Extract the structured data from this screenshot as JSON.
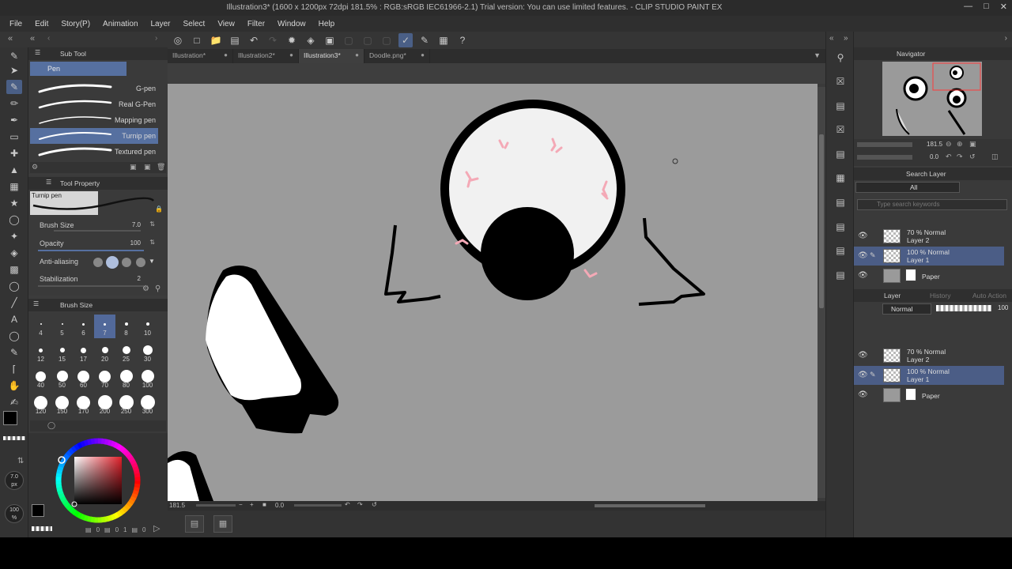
{
  "window": {
    "title": "Illustration3* (1600 x 1200px 72dpi 181.5% : RGB:sRGB IEC61966-2.1)  Trial version: You can use limited features. - CLIP STUDIO PAINT EX"
  },
  "menu": [
    "File",
    "Edit",
    "Story(P)",
    "Animation",
    "Layer",
    "Select",
    "View",
    "Filter",
    "Window",
    "Help"
  ],
  "tabs": [
    {
      "label": "Illustration*",
      "active": false
    },
    {
      "label": "Illustration2*",
      "active": false
    },
    {
      "label": "Illustration3*",
      "active": true
    },
    {
      "label": "Doodle.png*",
      "active": false
    }
  ],
  "subtool": {
    "panel_title": "Sub Tool",
    "group": "Pen",
    "items": [
      {
        "label": "G-pen",
        "selected": false
      },
      {
        "label": "Real G-Pen",
        "selected": false
      },
      {
        "label": "Mapping pen",
        "selected": false
      },
      {
        "label": "Turnip pen",
        "selected": true
      },
      {
        "label": "Textured pen",
        "selected": false
      }
    ]
  },
  "tool_property": {
    "panel_title": "Tool Property",
    "preview_label": "Turnip pen",
    "brush_size_label": "Brush Size",
    "brush_size_value": "7.0",
    "opacity_label": "Opacity",
    "opacity_value": "100",
    "antialiasing_label": "Anti-aliasing",
    "stabilization_label": "Stabilization",
    "stabilization_value": "2"
  },
  "brush_size_panel": {
    "title": "Brush Size",
    "sizes": [
      "4",
      "5",
      "6",
      "7",
      "8",
      "10",
      "12",
      "15",
      "17",
      "20",
      "25",
      "30",
      "40",
      "50",
      "60",
      "70",
      "80",
      "100",
      "120",
      "150",
      "170",
      "200",
      "250",
      "300"
    ],
    "selected": "7"
  },
  "color": {
    "main": "#000000",
    "sub": "#ffffff",
    "brush_size_readout": "7.0",
    "brush_size_unit": "px",
    "opacity_readout": "100",
    "opacity_unit": "%"
  },
  "color_wheel_values": [
    "0",
    "0",
    "1",
    "0",
    "0"
  ],
  "canvas_status": {
    "zoom": "181.5",
    "angle": "0.0"
  },
  "navigator": {
    "title": "Navigator",
    "zoom": "181.5",
    "angle": "0.0"
  },
  "search_layer": {
    "title": "Search Layer",
    "filter": "All",
    "placeholder": "Type search keywords"
  },
  "layer_panel": {
    "title": "Layer",
    "tab2": "History",
    "tab3": "Auto Action",
    "blend_mode": "Normal",
    "opacity": "100"
  },
  "layers_top": [
    {
      "l1": "70 % Normal",
      "l2": "Layer 2",
      "selected": false,
      "kind": "checker"
    },
    {
      "l1": "100 % Normal",
      "l2": "Layer 1",
      "selected": true,
      "kind": "checker"
    },
    {
      "l1": "",
      "l2": "Paper",
      "selected": false,
      "kind": "paper"
    }
  ],
  "layers_bottom": [
    {
      "l1": "70 % Normal",
      "l2": "Layer 2",
      "selected": false,
      "kind": "checker"
    },
    {
      "l1": "100 % Normal",
      "l2": "Layer 1",
      "selected": true,
      "kind": "checker"
    },
    {
      "l1": "",
      "l2": "Paper",
      "selected": false,
      "kind": "paper"
    }
  ],
  "colors": {
    "accent": "#4a5f86",
    "canvas_bg": "#9b9b9b",
    "vein": "#f4a0b0"
  }
}
